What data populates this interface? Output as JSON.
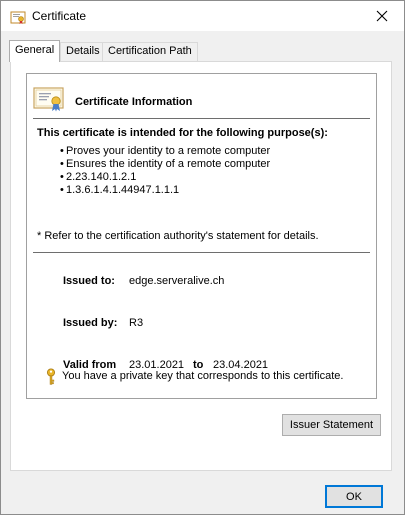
{
  "window": {
    "title": "Certificate"
  },
  "tabs": [
    {
      "label": "General"
    },
    {
      "label": "Details"
    },
    {
      "label": "Certification Path"
    }
  ],
  "info": {
    "title": "Certificate Information",
    "purpose_heading": "This certificate is intended for the following purpose(s):",
    "purposes": [
      "Proves your identity to a remote computer",
      "Ensures the identity of a remote computer",
      "2.23.140.1.2.1",
      "1.3.6.1.4.1.44947.1.1.1"
    ],
    "note": "* Refer to the certification authority's statement for details.",
    "issued_to_label": "Issued to:",
    "issued_to_value": "edge.serveralive.ch",
    "issued_by_label": "Issued by:",
    "issued_by_value": "R3",
    "valid_from_label": "Valid from",
    "valid_from_value": "23.01.2021",
    "valid_to_label": "to",
    "valid_to_value": "23.04.2021",
    "private_key_text": "You have a private key that corresponds to this certificate."
  },
  "buttons": {
    "issuer_statement": "Issuer Statement",
    "ok": "OK"
  },
  "icons": {
    "window": "certificate-icon",
    "info": "certificate-ribbon-icon",
    "key": "key-icon",
    "close": "close-icon"
  },
  "colors": {
    "accent": "#0078d7",
    "dialog_bg": "#f0f0f0",
    "key_gold": "#e8b52a"
  }
}
